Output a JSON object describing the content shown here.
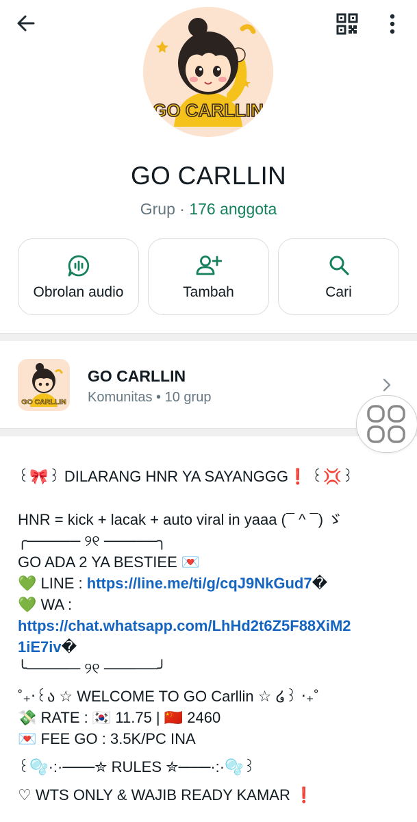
{
  "header": {
    "back_icon": "arrow-left-icon",
    "qr_icon": "qr-code-icon",
    "more_icon": "more-vertical-icon"
  },
  "group": {
    "avatar_text": "GO CARLLIN",
    "name": "GO CARLLIN",
    "type_label": "Grup · ",
    "member_count": "176 anggota"
  },
  "actions": [
    {
      "label": "Obrolan audio",
      "icon": "audio-chat-icon"
    },
    {
      "label": "Tambah",
      "icon": "add-person-icon"
    },
    {
      "label": "Cari",
      "icon": "search-icon"
    }
  ],
  "community": {
    "thumb_text": "GO CARLLIN",
    "name": "GO CARLLIN",
    "subtitle": "Komunitas • 10 grup"
  },
  "description": {
    "line1": "꒰🎀꒱ DILARANG HNR YA SAYANGGG❗️ ꒰💢꒱",
    "line2": "HNR = kick + lacak + auto viral in yaaa (¯ ^ ¯) ゞ",
    "frame_top": "╭───── ୨୧ ─────╮",
    "line3": "GO ADA 2 YA BESTIEE 💌",
    "line_label": "💚 LINE : ",
    "line_link": "https://line.me/ti/g/cqJ9NkGud7",
    "line_suffix": "�",
    "wa_label": "💚 WA :",
    "wa_link_1": "https://chat.whatsapp.com/LhHd2t6Z5F88XiM2",
    "wa_link_2": "1iE7iv",
    "wa_suffix": "�",
    "frame_bottom": "╰───── ୨୧ ─────╯",
    "welcome": "˚₊‧꒰ა ☆ WELCOME TO GO Carllin ☆ ໒꒱ ‧₊˚",
    "rate": "💸 RATE : 🇰🇷 11.75 | 🇨🇳 2460",
    "fee": "💌 FEE GO : 3.5K/PC INA",
    "rules": "꒰🫧·:·───✮ RULES ✮───·:·🫧꒱",
    "wts": "♡ WTS ONLY & WAJIB READY KAMAR ❗️"
  },
  "colors": {
    "accent_green": "#15805d",
    "link_blue": "#1565c0",
    "avatar_bg": "#fbe3cf"
  }
}
